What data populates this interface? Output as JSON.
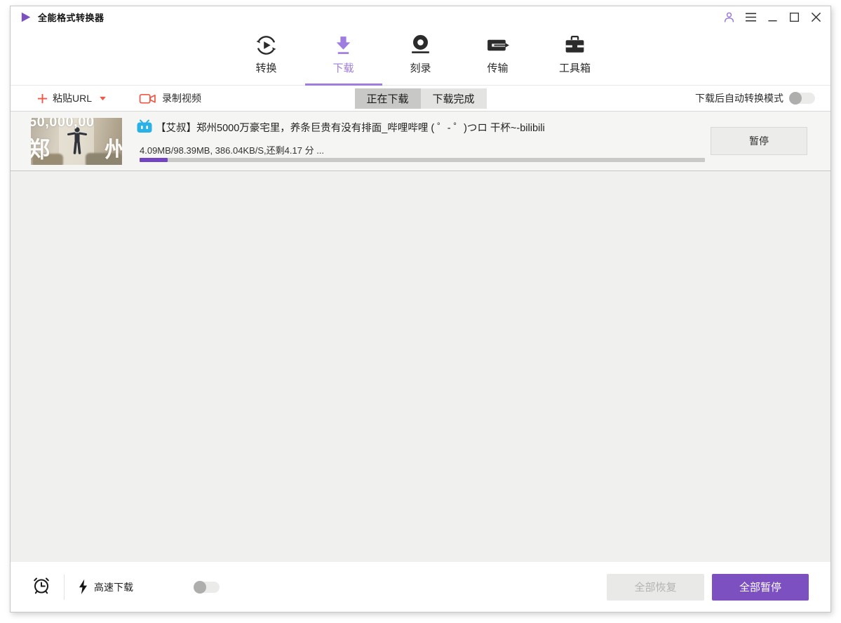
{
  "window": {
    "title": "全能格式转换器"
  },
  "nav": {
    "tabs": [
      {
        "label": "转换"
      },
      {
        "label": "下载"
      },
      {
        "label": "刻录"
      },
      {
        "label": "传输"
      },
      {
        "label": "工具箱"
      }
    ],
    "active_index": 1
  },
  "toolbar": {
    "paste_url_label": "粘贴URL",
    "record_video_label": "录制视频",
    "filter_tabs": [
      {
        "label": "正在下载"
      },
      {
        "label": "下载完成"
      }
    ],
    "active_filter": "正在下载",
    "auto_convert_label": "下载后自动转换模式",
    "auto_convert_on": false
  },
  "download_item": {
    "source": "bilibili",
    "title": "【艾叔】郑州5000万豪宅里，养条巨贵有没有排面_哔哩哔哩 ( ゜- ゜)つロ 干杯~-bilibili",
    "progress_text": "4.09MB/98.39MB, 386.04KB/S,还剩4.17 分 ...",
    "progress_percent": 5,
    "pause_label": "暂停",
    "thumbnail": {
      "overlay_top": "50,000,00",
      "overlay_left": "郑",
      "overlay_right": "州"
    }
  },
  "footer": {
    "high_speed_label": "高速下载",
    "high_speed_on": false,
    "resume_all_label": "全部恢复",
    "pause_all_label": "全部暂停"
  },
  "colors": {
    "accent_purple": "#7d50c2",
    "light_purple": "#9e7ce0",
    "accent_red": "#f05744",
    "bilibili_blue": "#2ab2e8"
  }
}
